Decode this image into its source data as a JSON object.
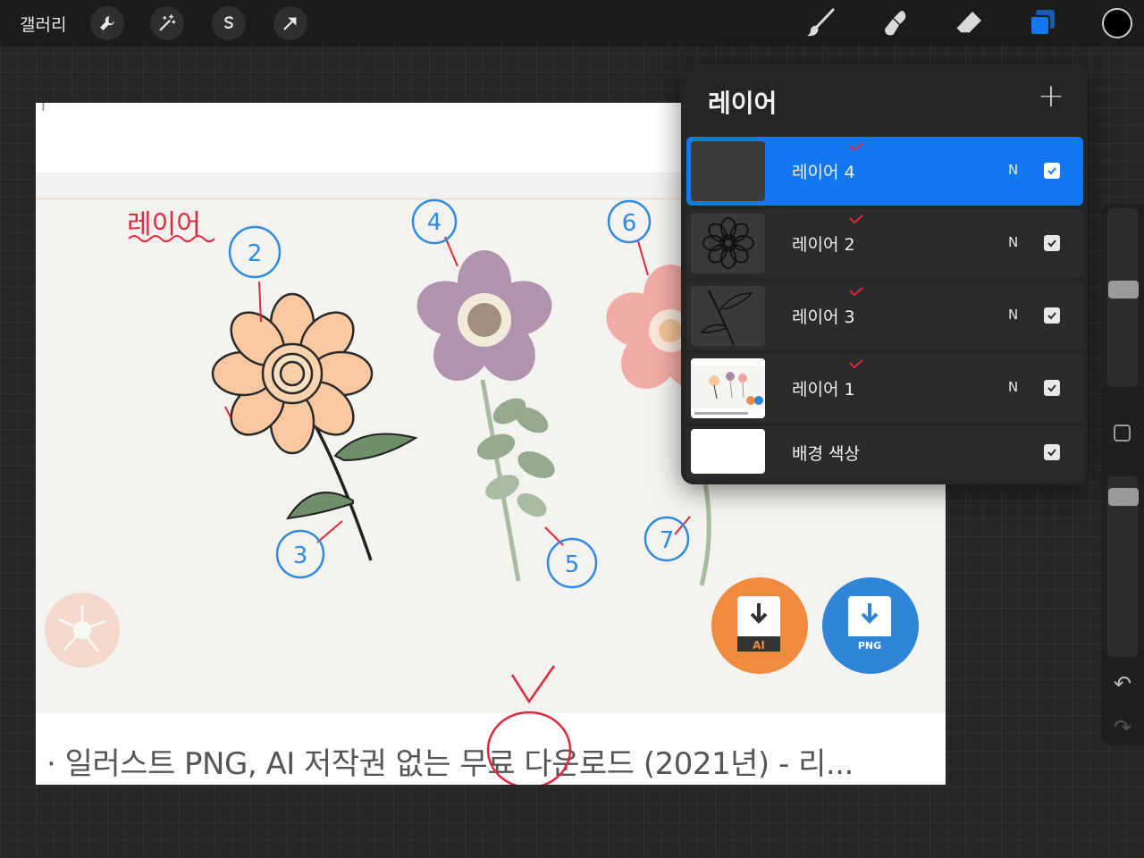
{
  "toolbar": {
    "gallery_label": "갤러리",
    "left_tools": [
      "wrench-icon",
      "magic-wand-icon",
      "selection-s-icon",
      "arrow-transform-icon"
    ],
    "right_tools": [
      "brush-icon",
      "smudge-icon",
      "eraser-icon",
      "layers-icon",
      "color-picker-icon"
    ],
    "active_color": "#000000",
    "accent": "#1378f0"
  },
  "canvas": {
    "handwritten_label": "레이어",
    "circled_numbers": [
      "2",
      "3",
      "4",
      "5",
      "6",
      "7"
    ],
    "badges": [
      "AI",
      "PNG"
    ],
    "caption": "· 일러스트 PNG, AI 저작권 없는 무료 다운로드 (2021년) - 리..."
  },
  "layers_panel": {
    "title": "레이어",
    "add_label": "+",
    "layers": [
      {
        "name": "레이어 4",
        "mode": "N",
        "visible": true,
        "active": true
      },
      {
        "name": "레이어 2",
        "mode": "N",
        "visible": true,
        "active": false
      },
      {
        "name": "레이어 3",
        "mode": "N",
        "visible": true,
        "active": false
      },
      {
        "name": "레이어 1",
        "mode": "N",
        "visible": true,
        "active": false
      },
      {
        "name": "배경 색상",
        "mode": "",
        "visible": true,
        "active": false
      }
    ]
  },
  "sidebar": {
    "brush_size_level": 0.55,
    "opacity_level": 0.93,
    "undo_icon": "undo-icon",
    "redo_icon": "redo-icon"
  }
}
